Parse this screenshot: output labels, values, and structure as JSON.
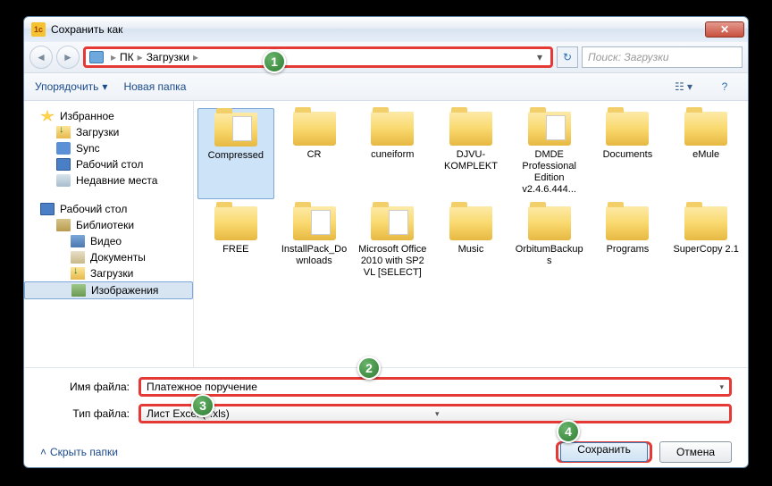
{
  "title": "Сохранить как",
  "breadcrumb": {
    "root": "ПК",
    "folder": "Загрузки"
  },
  "search_placeholder": "Поиск: Загрузки",
  "toolbar": {
    "organize": "Упорядочить",
    "new_folder": "Новая папка"
  },
  "sidebar": {
    "favorites": "Избранное",
    "downloads": "Загрузки",
    "sync": "Sync",
    "desktop": "Рабочий стол",
    "recent": "Недавние места",
    "desktop2": "Рабочий стол",
    "libraries": "Библиотеки",
    "videos": "Видео",
    "documents": "Документы",
    "downloads2": "Загрузки",
    "images": "Изображения"
  },
  "files": [
    "Compressed",
    "CR",
    "cuneiform",
    "DJVU-KOMPLEKT",
    "DMDE Professional Edition v2.4.6.444...",
    "Documents",
    "eMule",
    "FREE",
    "InstallPack_Downloads",
    "Microsoft Office 2010 with SP2 VL [SELECT]",
    "Music",
    "OrbitumBackups",
    "Programs",
    "SuperCopy 2.1"
  ],
  "form": {
    "name_label": "Имя файла:",
    "name_value": "Платежное поручение",
    "type_label": "Тип файла:",
    "type_value": "Лист Excel (*.xls)"
  },
  "footer": {
    "hide": "Скрыть папки",
    "save": "Сохранить",
    "cancel": "Отмена"
  },
  "callouts": {
    "c1": "1",
    "c2": "2",
    "c3": "3",
    "c4": "4"
  }
}
